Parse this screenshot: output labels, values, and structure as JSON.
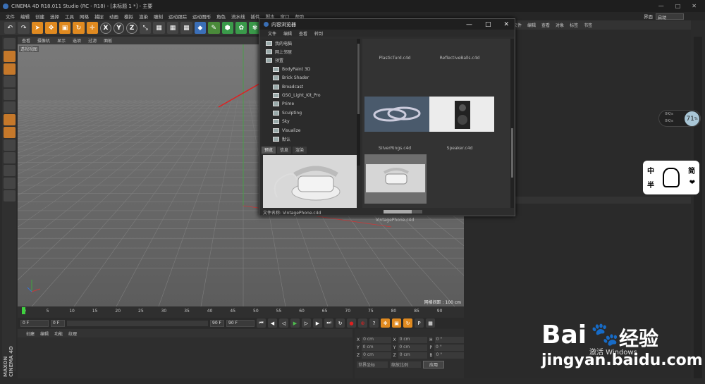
{
  "window": {
    "title": "CINEMA 4D R18.011 Studio (RC - R18) - [未标题 1 *] - 主要",
    "controls": [
      "—",
      "□",
      "✕"
    ]
  },
  "menubar": {
    "items": [
      "文件",
      "编辑",
      "创建",
      "选择",
      "工具",
      "网格",
      "捕捉",
      "动画",
      "模拟",
      "渲染",
      "雕刻",
      "运动跟踪",
      "运动图形",
      "角色",
      "流水线",
      "插件",
      "脚本",
      "窗口",
      "帮助"
    ],
    "layout_label": "界面",
    "layout_value": "启动"
  },
  "viewport": {
    "menu": [
      "查看",
      "摄像机",
      "显示",
      "选项",
      "过滤",
      "面板"
    ],
    "label": "透视视图",
    "grid_info": "网格间距 : 100 cm"
  },
  "timeline": {
    "ticks": [
      "0",
      "5",
      "10",
      "15",
      "20",
      "25",
      "30",
      "35",
      "40",
      "45",
      "50",
      "55",
      "60",
      "65",
      "70",
      "75",
      "80",
      "85",
      "90"
    ],
    "start_frame": "0 F",
    "current_frame": "0 F",
    "end_frame": "90 F",
    "end_frame2": "90 F",
    "right_marker": "0 F"
  },
  "material_panel": {
    "menu": [
      "创建",
      "编辑",
      "功能",
      "纹理"
    ]
  },
  "coord_panel": {
    "rows": [
      {
        "a": "X",
        "av": "0 cm",
        "b": "X",
        "bv": "0 cm",
        "c": "H",
        "cv": "0 °"
      },
      {
        "a": "Y",
        "av": "0 cm",
        "b": "Y",
        "bv": "0 cm",
        "c": "P",
        "cv": "0 °"
      },
      {
        "a": "Z",
        "av": "0 cm",
        "b": "Z",
        "bv": "0 cm",
        "c": "B",
        "cv": "0 °"
      }
    ],
    "mode1": "世界坐标",
    "mode2": "缩放比例",
    "apply": "应用"
  },
  "right_panel": {
    "menu": [
      "文件",
      "编辑",
      "查看",
      "对象",
      "标签",
      "书签"
    ]
  },
  "content_browser": {
    "title": "内容浏览器",
    "menu": [
      "文件",
      "编辑",
      "查看",
      "转到"
    ],
    "tree": [
      "我的电脑",
      "网上邻居",
      "预置",
      "BodyPaint 3D",
      "Brick Shader",
      "Broadcast",
      "GSG_Light_Kit_Pro",
      "Prime",
      "Sculpting",
      "Sky",
      "Visualize",
      "默认"
    ],
    "preview_tabs": [
      "预览",
      "信息",
      "渲染"
    ],
    "file_name_label": "文件名称:",
    "file_name": "VintagePhone.c4d",
    "thumbnails": [
      "PlasticTurd.c4d",
      "ReflectiveBalls.c4d",
      "SilverRings.c4d",
      "Speaker.c4d",
      "VintagePhone.c4d"
    ]
  },
  "clock_widget": {
    "value": "71",
    "unit": "%",
    "up": "0K/s",
    "down": "0K/s"
  },
  "sticker": {
    "chars": [
      "中",
      "简",
      "半",
      "❤"
    ]
  },
  "watermark": {
    "activate": "激活 Windows",
    "brand": "Bai",
    "brand2": "经验",
    "url": "jingyan.baidu.com"
  },
  "branding": {
    "maxon": "MAXON CINEMA 4D"
  },
  "colors": {
    "accent": "#e08a20",
    "viewport_bg": "#6a6a6a",
    "arrow": "#e02020"
  }
}
